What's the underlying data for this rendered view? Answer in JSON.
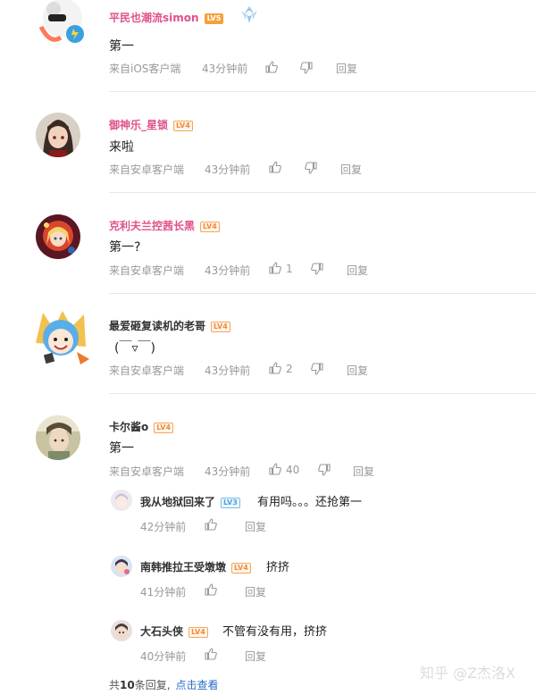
{
  "comments": [
    {
      "name": "平民也潮流simon",
      "level": "LV5",
      "text": "第一",
      "source": "来自iOS客户端",
      "time": "43分钟前",
      "like_count": "",
      "reply_label": "回复"
    },
    {
      "name": "御神乐_星锁",
      "level": "LV4",
      "text": "来啦",
      "source": "来自安卓客户端",
      "time": "43分钟前",
      "like_count": "",
      "reply_label": "回复"
    },
    {
      "name": "克利夫兰控茜长黑",
      "level": "LV4",
      "text": "第一?",
      "source": "来自安卓客户端",
      "time": "43分钟前",
      "like_count": "1",
      "reply_label": "回复"
    },
    {
      "name": "最爱砸复读机的老哥",
      "level": "LV4",
      "text": "(￣▿￣)",
      "source": "来自安卓客户端",
      "time": "43分钟前",
      "like_count": "2",
      "reply_label": "回复"
    },
    {
      "name": "卡尔酱o",
      "level": "LV4",
      "text": "第一",
      "source": "来自安卓客户端",
      "time": "43分钟前",
      "like_count": "40",
      "reply_label": "回复"
    }
  ],
  "replies": [
    {
      "name": "我从地狱回来了",
      "level": "LV3",
      "text": "有用吗。。。还抢第一",
      "time": "42分钟前",
      "reply_label": "回复"
    },
    {
      "name": "南韩推拉王受墩墩",
      "level": "LV4",
      "text": "挤挤",
      "time": "41分钟前",
      "reply_label": "回复"
    },
    {
      "name": "大石头侠",
      "level": "LV4",
      "text": "不管有没有用，挤挤",
      "time": "40分钟前",
      "reply_label": "回复"
    }
  ],
  "footer": {
    "prefix": "共",
    "count": "10",
    "suffix": "条回复,",
    "link": "点击查看"
  },
  "watermark": "知乎 @Z杰洛X",
  "colors": {
    "pink_name": "#e0528a",
    "link": "#2b6dc6",
    "meta": "#999999"
  }
}
